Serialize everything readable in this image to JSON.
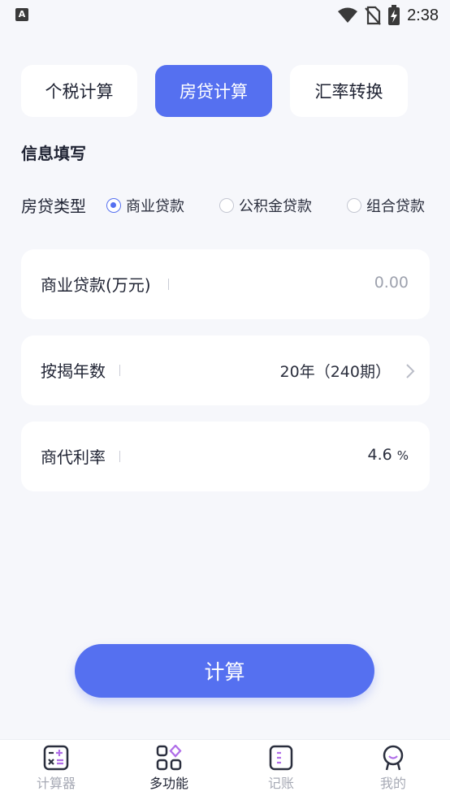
{
  "status_bar": {
    "app_badge": "A",
    "time": "2:38"
  },
  "tabs": [
    {
      "label": "个税计算",
      "active": false
    },
    {
      "label": "房贷计算",
      "active": true
    },
    {
      "label": "汇率转换",
      "active": false
    }
  ],
  "section_title": "信息填写",
  "loan_type": {
    "label": "房贷类型",
    "options": [
      {
        "label": "商业贷款",
        "checked": true
      },
      {
        "label": "公积金贷款",
        "checked": false
      },
      {
        "label": "组合贷款",
        "checked": false
      }
    ]
  },
  "fields": {
    "commercial_loan": {
      "label": "商业贷款(万元)",
      "placeholder": "0.00"
    },
    "years": {
      "label": "按揭年数",
      "value": "20年（240期）"
    },
    "rate": {
      "label": "商代利率",
      "value": "4.6",
      "unit": "%"
    }
  },
  "calc_button": "计算",
  "bottom_nav": [
    {
      "label": "计算器",
      "icon": "calculator-icon",
      "active": false
    },
    {
      "label": "多功能",
      "icon": "apps-icon",
      "active": true
    },
    {
      "label": "记账",
      "icon": "ledger-icon",
      "active": false
    },
    {
      "label": "我的",
      "icon": "profile-icon",
      "active": false
    }
  ],
  "colors": {
    "accent": "#5570f0",
    "accent_secondary": "#b06ee8",
    "background": "#f6f7fb"
  }
}
